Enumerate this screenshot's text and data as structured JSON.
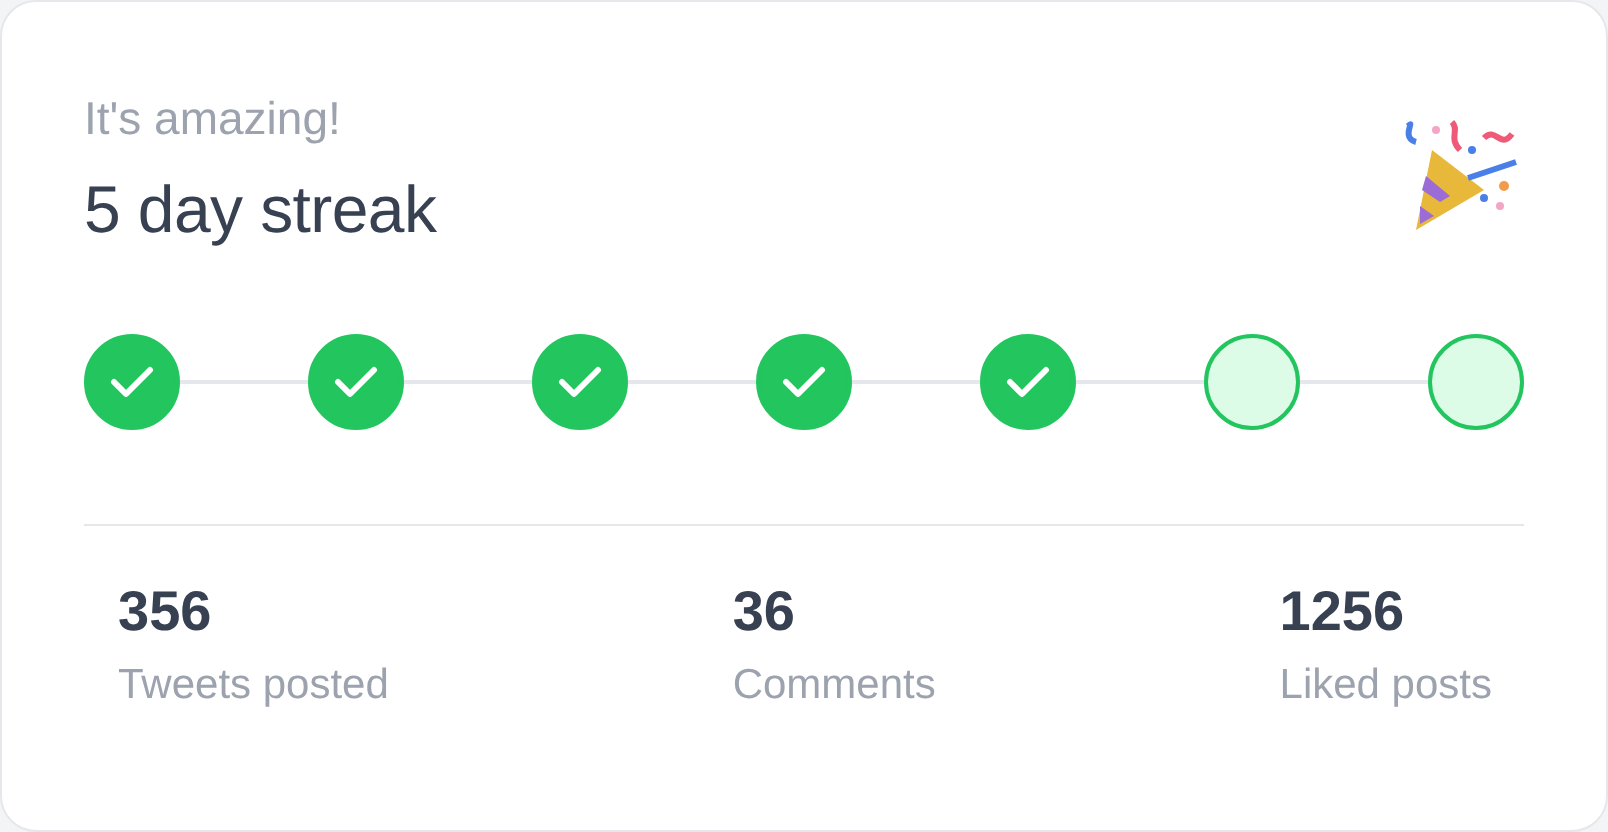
{
  "card": {
    "subtitle": "It's amazing!",
    "title": "5 day streak"
  },
  "days": [
    {
      "done": true
    },
    {
      "done": true
    },
    {
      "done": true
    },
    {
      "done": true
    },
    {
      "done": true
    },
    {
      "done": false
    },
    {
      "done": false
    }
  ],
  "stats": [
    {
      "value": "356",
      "label": "Tweets posted"
    },
    {
      "value": "36",
      "label": "Comments"
    },
    {
      "value": "1256",
      "label": "Liked posts"
    }
  ]
}
